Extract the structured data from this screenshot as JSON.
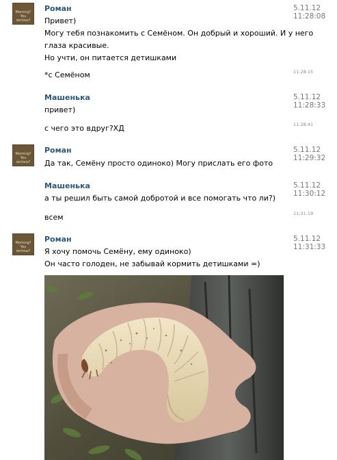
{
  "messages": [
    {
      "author": "Роман",
      "date": "5.11.12",
      "time": "11:28:08",
      "lines": [
        "Привет)",
        "Могу тебя познакомить с Семёном. Он добрый и хороший. И у него",
        "глаза красивые.",
        "Но учти, он питается детишками"
      ]
    },
    {
      "text": "*с Семёном",
      "time": "11:28:15"
    },
    {
      "author": "Машенька",
      "date": "5.11.12",
      "time": "11:28:33",
      "lines": [
        "привет)"
      ]
    },
    {
      "text": "с чего это вдруг?ХД",
      "time": "11:28:41"
    },
    {
      "author": "Роман",
      "date": "5.11.12",
      "time": "11:29:32",
      "lines": [
        "Да так, Семёну просто одиноко) Могу прислать его фото"
      ]
    },
    {
      "author": "Машенька",
      "date": "5.11.12",
      "time": "11:30:12",
      "lines": [
        "а ты решил быть самой добротой и все помогать что ли?)"
      ]
    },
    {
      "text": "всем",
      "time": "11:31:19"
    },
    {
      "author": "Роман",
      "date": "5.11.12",
      "time": "11:31:33",
      "lines": [
        "Я хочу помочь Семёну, ему одиноко)",
        "Он часто голоден, не забывай кормить детишками =)"
      ]
    }
  ],
  "avatar_text": "Morning? You serious?",
  "colors": {
    "author": "#2b587a",
    "date": "#777777"
  }
}
